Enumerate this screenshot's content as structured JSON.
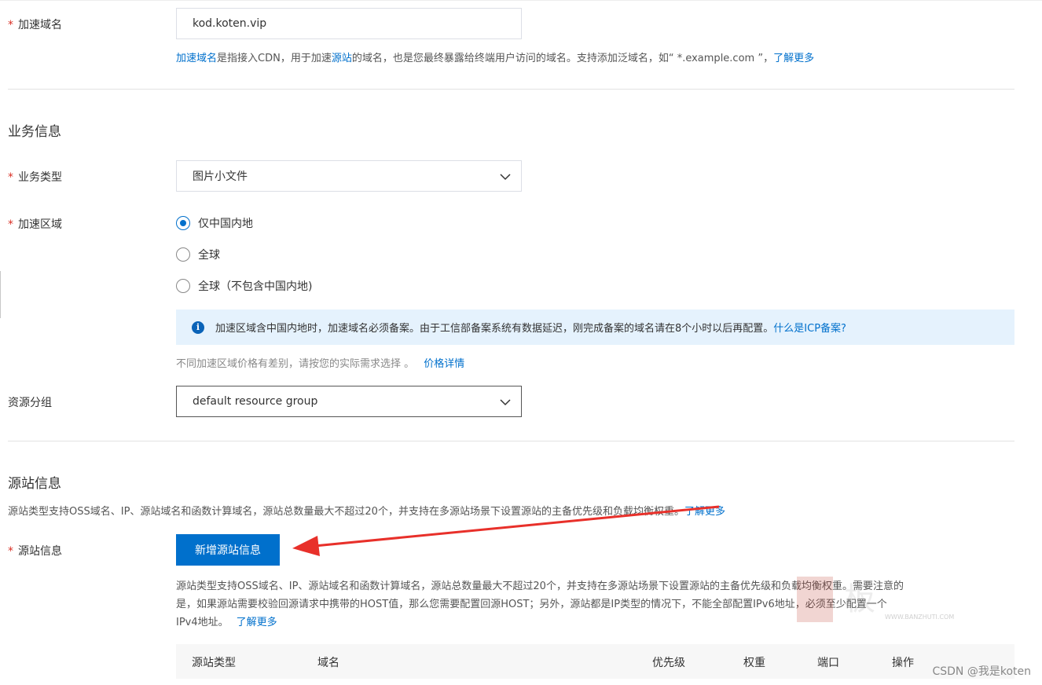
{
  "domain_field": {
    "label": "加速域名",
    "required_mark": "*",
    "value": "kod.koten.vip",
    "help_link_1": "加速域名",
    "help_text_1": "是指接入CDN，用于加速",
    "help_link_2": "源站",
    "help_text_2": "的域名，也是您最终暴露给终端用户访问的域名。支持添加泛域名，如“ *.example.com ”，",
    "help_link_3": "了解更多"
  },
  "business_section": {
    "title": "业务信息",
    "type_label": "业务类型",
    "type_value": "图片小文件",
    "region_label": "加速区域",
    "region_options": [
      {
        "label": "仅中国内地",
        "selected": true
      },
      {
        "label": "全球",
        "selected": false
      },
      {
        "label": "全球（不包含中国内地)",
        "selected": false
      }
    ],
    "notice_text": "加速区域含中国内地时，加速域名必须备案。由于工信部备案系统有数据延迟，刚完成备案的域名请在8个小时以后再配置。",
    "notice_link": "什么是ICP备案?",
    "price_text": "不同加速区域价格有差别，请按您的实际需求选择 。",
    "price_link": "价格详情",
    "resource_label": "资源分组",
    "resource_value": "default resource group"
  },
  "origin_section": {
    "title": "源站信息",
    "desc_text": "源站类型支持OSS域名、IP、源站域名和函数计算域名，源站总数量最大不超过20个，并支持在多源站场景下设置源站的主备优先级和负载均衡权重。",
    "desc_link": "了解更多",
    "field_label": "源站信息",
    "add_button": "新增源站信息",
    "help_line_1": "源站类型支持OSS域名、IP、源站域名和函数计算域名，源站总数量最大不超过20个，并支持在多源站场景下设置源站的主备优先级和负载均衡权重。需要注意的",
    "help_line_2": "是，如果源站需要校验回源请求中携带的HOST值，那么您需要配置回源HOST；另外，源站都是IP类型的情况下，不能全部配置IPv6地址，必须至少配置一个",
    "help_line_3": "IPv4地址。",
    "help_link": "了解更多",
    "table_columns": [
      "源站类型",
      "域名",
      "优先级",
      "权重",
      "端口",
      "操作"
    ]
  },
  "watermark": "CSDN @我是koten",
  "stamp_text": "WWW.BANZHUTI.COM",
  "colors": {
    "primary": "#0070cc",
    "required": "#d93026",
    "notice_bg": "#e5f2fd",
    "arrow": "#e8302a"
  },
  "icons": {
    "chevron": "chevron-down-icon",
    "info": "info-icon",
    "arrow": "red-arrow-annotation"
  }
}
